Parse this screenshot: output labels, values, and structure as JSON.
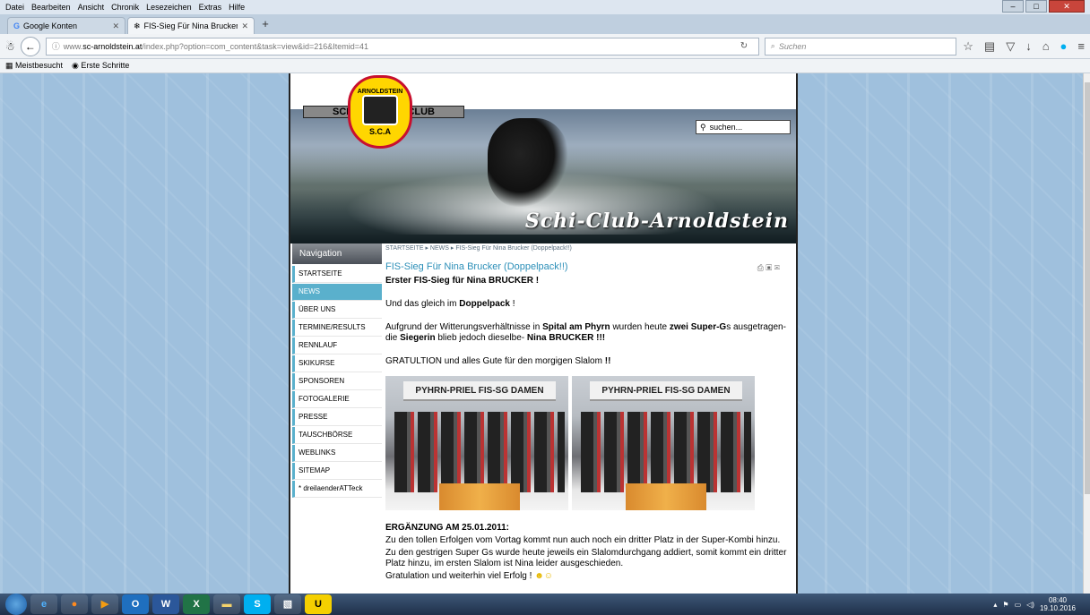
{
  "menubar": {
    "items": [
      "Datei",
      "Bearbeiten",
      "Ansicht",
      "Chronik",
      "Lesezeichen",
      "Extras",
      "Hilfe"
    ]
  },
  "tabs": [
    {
      "label": "Google Konten",
      "icon": "google-icon"
    },
    {
      "label": "FIS-Sieg Für Nina Brucker (...",
      "icon": "snowflake-icon"
    }
  ],
  "urlbar": {
    "prefix": "www.",
    "host": "sc-arnoldstein.at",
    "path": "/index.php?option=com_content&task=view&id=216&Itemid=41"
  },
  "searchbar": {
    "placeholder": "Suchen"
  },
  "bookmarks": [
    "Meistbesucht",
    "Erste Schritte"
  ],
  "site": {
    "banner_left": "SCHI-",
    "banner_right": "CLUB",
    "crest_top": "ARNOLDSTEIN",
    "crest_bottom": "S.C.A",
    "title": "Schi-Club-Arnoldstein",
    "search_value": "suchen..."
  },
  "nav": {
    "heading": "Navigation",
    "items": [
      "STARTSEITE",
      "NEWS",
      "ÜBER UNS",
      "TERMINE/RESULTS",
      "RENNLAUF",
      "SKIKURSE",
      "SPONSOREN",
      "FOTOGALERIE",
      "PRESSE",
      "TAUSCHBÖRSE",
      "WEBLINKS",
      "SITEMAP",
      "* dreilaenderATTeck"
    ]
  },
  "article": {
    "breadcrumb": "STARTSEITE ▸ NEWS ▸ FIS-Sieg Für Nina Brucker (Doppelpack!!)",
    "title": "FIS-Sieg Für Nina Brucker (Doppelpack!!)",
    "p1": "Erster FIS-Sieg für Nina BRUCKER !",
    "p2_a": "Und das gleich im ",
    "p2_b": "Doppelpack",
    "p2_c": " !",
    "p3_a": "Aufgrund der Witterungsverhältnisse in ",
    "p3_b": "Spital am Phyrn",
    "p3_c": " wurden heute ",
    "p3_d": "zwei Super-G",
    "p3_e": "s ausgetragen-die ",
    "p3_f": "Siegerin",
    "p3_g": " blieb jedoch dieselbe- ",
    "p3_h": "Nina BRUCKER !!!",
    "p4_a": "GRATULTION und alles Gute für den morgigen Slalom ",
    "p4_b": "!!",
    "photo1_banner": "PYHRN-PRIEL  FIS-SG DAMEN",
    "photo2_banner": "PYHRN-PRIEL  FIS-SG DAMEN",
    "update_heading": "ERGÄNZUNG AM 25.01.2011:",
    "update_l1": "Zu den tollen Erfolgen vom Vortag kommt nun auch noch ein dritter Platz in der Super-Kombi hinzu.",
    "update_l2": "Zu den gestrigen Super Gs wurde heute jeweils ein Slalomdurchgang  addiert, somit kommt ein dritter Platz hinzu, im ersten Slalom ist Nina leider ausgeschieden.",
    "update_l3": "Gratulation und weiterhin viel Erfolg !"
  },
  "taskbar": {
    "time": "08:40",
    "date": "19.10.2016"
  }
}
